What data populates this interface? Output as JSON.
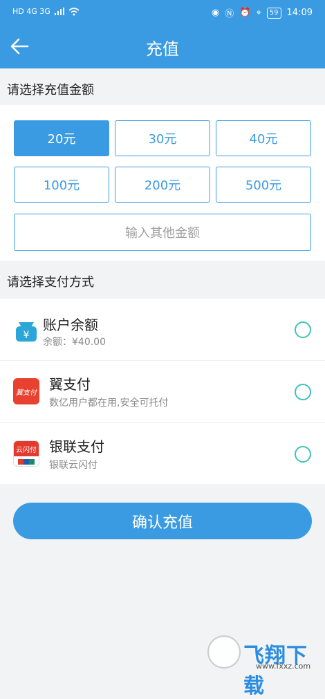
{
  "status_bar": {
    "left_indicators": "HD  4G  3G",
    "time": "14:09",
    "battery": "59"
  },
  "header": {
    "title": "充值"
  },
  "amount_section": {
    "title": "请选择充值金额",
    "options": [
      "20元",
      "30元",
      "40元",
      "100元",
      "200元",
      "500元"
    ],
    "selected_index": 0,
    "other_placeholder": "输入其他金额"
  },
  "payment_section": {
    "title": "请选择支付方式",
    "methods": [
      {
        "name": "账户余额",
        "subtitle": "余额：¥40.00",
        "icon": "wallet-icon"
      },
      {
        "name": "翼支付",
        "subtitle": "数亿用户都在用,安全可托付",
        "icon": "bestpay-icon",
        "icon_text": "翼支付"
      },
      {
        "name": "银联支付",
        "subtitle": "银联云闪付",
        "icon": "unionpay-icon",
        "icon_text": "云闪付"
      }
    ]
  },
  "confirm_button": "确认充值",
  "watermark": {
    "brand": "飞翔下载",
    "url": "www.fxxz.com"
  },
  "colors": {
    "primary": "#3a9be3",
    "radio": "#3ec3b6",
    "background": "#f2f3f5"
  }
}
